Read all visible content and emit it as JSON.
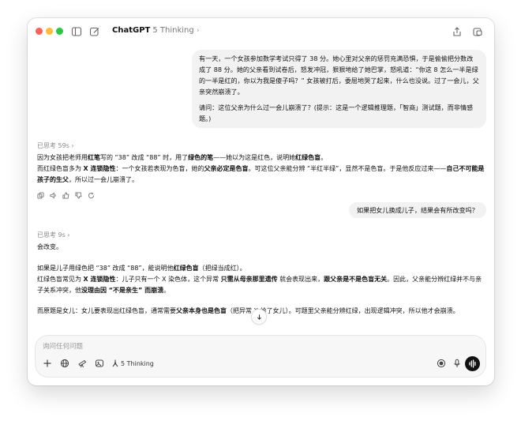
{
  "window": {
    "app_name": "ChatGPT",
    "model_label": "5 Thinking",
    "model_chevron": "chevron-right-icon",
    "toolbar_icons": [
      "sidebar-icon",
      "new-chat-icon",
      "share-icon",
      "window-icon"
    ]
  },
  "conversation": {
    "user_message_1": {
      "para1": "有一天，一个女孩参加数学考试只得了 38 分。她心里对父亲的惩罚充满恐惧，于是偷偷把分数改成了 88 分。她的父亲看到试卷后，怒发冲冠，狠狠地给了她巴掌，怒吼道：“你这 8 怎么一半是绿的一半是红的，你以为我是傻子吗？” 女孩被打后，委屈地哭了起来，什么也没说。过了一会儿，父亲突然崩溃了。",
      "para2": "请问：这位父亲为什么过一会儿崩溃了？(提示：这是一个逻辑推理题，「智商」测试题，而非情感题。)"
    },
    "thought_1": "已思考 59s ›",
    "answer_1": {
      "line1_a": "因为女孩把老师用",
      "line1_b": "红笔",
      "line1_c": "写的 “38” 改成 “88” 时，用了",
      "line1_d": "绿色的笔",
      "line1_e": "——她以为这是红色，说明她",
      "line1_f": "红绿色盲",
      "line1_g": "。",
      "line2_a": "而红绿色盲多为 ",
      "line2_b": "X 连锁隐性",
      "line2_c": "：一个女孩若表现为色盲，她的",
      "line2_d": "父亲必定是色盲",
      "line2_e": "。可这位父亲能分辨 “半红半绿”，显然不是色盲。于是他反应过来——",
      "line2_f": "自己不可能是孩子的生父",
      "line2_g": "，所以过一会儿崩溃了。"
    },
    "action_icons": [
      "copy-icon",
      "speaker-icon",
      "thumbs-up-icon",
      "thumbs-down-icon",
      "regenerate-icon"
    ],
    "user_message_2": "如果把女儿换成儿子，结果会有所改变吗？",
    "thought_2": "已思考 9s ›",
    "answer_2": {
      "p1": "会改变。",
      "p2_a": "如果是儿子用绿色把 “38” 改成 “88”，能说明他",
      "p2_b": "红绿色盲",
      "p2_c": "（把绿当成红）。",
      "p3_a": "红绿色盲常见为 ",
      "p3_b": "X 连锁隐性",
      "p3_c": "：儿子只有一个 X 染色体，这个异常 ",
      "p3_d": "只需从母亲那里遗传",
      "p3_e": " 就会表现出来，",
      "p3_f": "跟父亲是不是色盲无关",
      "p3_g": "。因此，父亲能分辨红绿并不与亲子关系冲突，他",
      "p3_h": "没理由因 “不是亲生” 而崩溃",
      "p3_i": "。",
      "p4_a": "而原题是女儿：女儿要表现出红绿色盲，通常需要",
      "p4_b": "父亲本身也是色盲",
      "p4_c": "（把异常 X 给了女儿）。可题里父亲能分辨红绿，出现逻辑冲突，所以他才会崩溃。"
    }
  },
  "composer": {
    "placeholder": "询问任何问题",
    "mode_label": "5 Thinking",
    "icons": [
      "plus-icon",
      "globe-icon",
      "telescope-icon",
      "image-icon",
      "tools-icon",
      "record-icon",
      "mic-icon",
      "voice-icon"
    ]
  }
}
